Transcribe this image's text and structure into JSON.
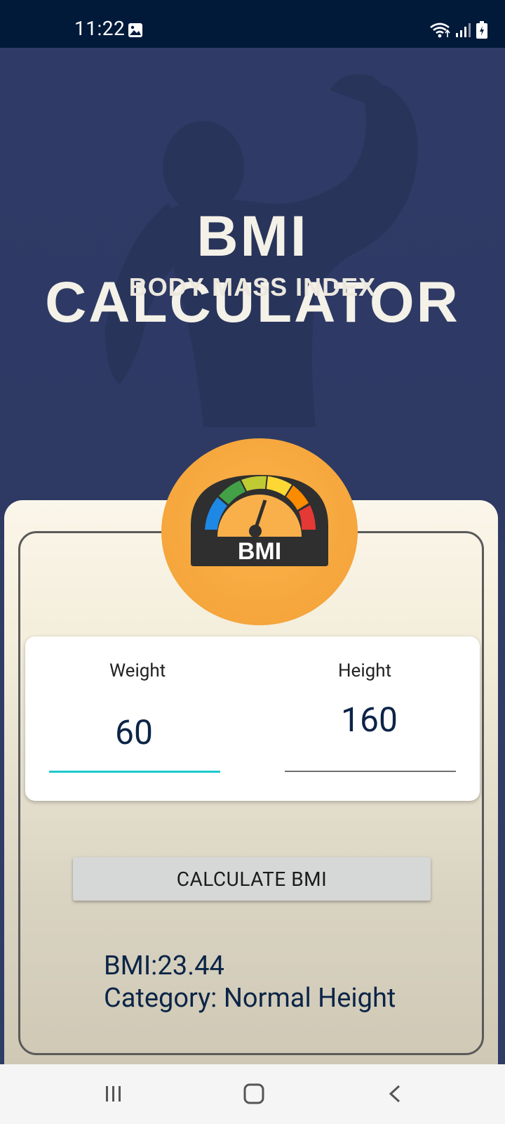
{
  "status_bar": {
    "time": "11:22",
    "icons": [
      "image-icon",
      "wifi-icon",
      "signal-icon",
      "battery-charging-icon"
    ]
  },
  "hero": {
    "title": "BMI CALCULATOR",
    "subtitle": "BODY MASS INDEX"
  },
  "gauge": {
    "label": "BMI"
  },
  "form": {
    "weight_label": "Weight",
    "weight_value": "60",
    "height_label": "Height",
    "height_value": "160"
  },
  "actions": {
    "calculate_label": "CALCULATE BMI"
  },
  "result": {
    "bmi_line": "BMI:23.44",
    "category_line": "Category: Normal Height"
  },
  "nav_bar": {
    "buttons": [
      "recents-icon",
      "home-icon",
      "back-icon"
    ]
  },
  "colors": {
    "status_bar_bg": "#021a3a",
    "hero_bg": "#2f3c66",
    "gauge_orange": "#f5a63c",
    "accent_underline": "#1ec9cf",
    "text_navy": "#0b2547",
    "button_bg": "#d6d7d7"
  }
}
